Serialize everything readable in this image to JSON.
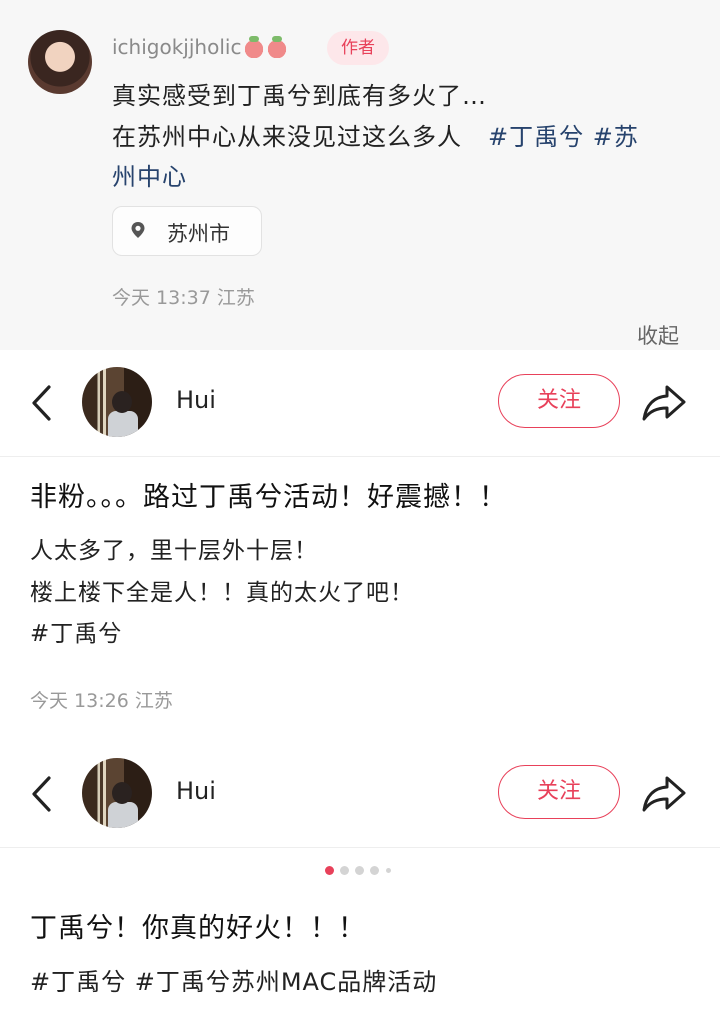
{
  "quoted_post": {
    "username": "ichigokjjholic",
    "author_badge": "作者",
    "line1": "真实感受到丁禹兮到底有多火了…",
    "line2_text": "在苏州中心从来没见过这么多人",
    "line2_tag1": "#丁禹兮",
    "line2_tag2": "#苏",
    "line3_tag": "州中心",
    "location": "苏州市",
    "time": "今天 13:37 江苏",
    "collapse_label": "收起"
  },
  "post1": {
    "author": "Hui",
    "follow_label": "关注",
    "title": "非粉。。。路过丁禹兮活动！好震撼！！",
    "body_line1": "人太多了，里十层外十层！",
    "body_line2": "楼上楼下全是人！！真的太火了吧！",
    "tag": "#丁禹兮",
    "time": "今天 13:26 江苏"
  },
  "post2": {
    "author": "Hui",
    "follow_label": "关注",
    "image_carousel": {
      "total": 5,
      "current": 1
    },
    "title": "丁禹兮！你真的好火！！！",
    "tags": "#丁禹兮 #丁禹兮苏州MAC品牌活动"
  },
  "colors": {
    "accent": "#e8415a",
    "tag": "#27436d",
    "muted": "#999999"
  }
}
